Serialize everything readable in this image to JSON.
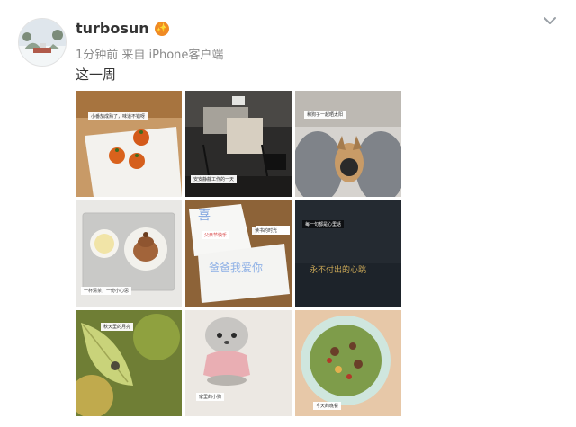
{
  "post": {
    "username": "turbosun",
    "vip_badge": "✨",
    "meta": "1分钟前 来自 iPhone客户端",
    "text": "这一周"
  },
  "photos": [
    {
      "caption": "小番茄成熟了，味道不错呀"
    },
    {
      "caption": "安安静静工作的一天"
    },
    {
      "caption": "和狗子一起晒太阳"
    },
    {
      "caption": "一杯清茶，一份小心思"
    },
    {
      "card_top": "喜",
      "card_mid": "爸爸我爱你",
      "card_small": "父亲节快乐",
      "side_note": "读书的时光"
    },
    {
      "caption": "每一句都是心里话",
      "gold": "永不付出的心跳"
    },
    {
      "caption": "秋天里的月亮"
    },
    {
      "caption": "家里的小狗"
    },
    {
      "caption": "今天的晚餐"
    }
  ],
  "colors": {
    "username": "#333333",
    "meta": "#8a8a8a",
    "vip": "#f08a24",
    "chevron": "#9aa0a6"
  },
  "icons": {
    "chevron": "chevron-down-icon",
    "vip": "vip-badge-icon"
  }
}
